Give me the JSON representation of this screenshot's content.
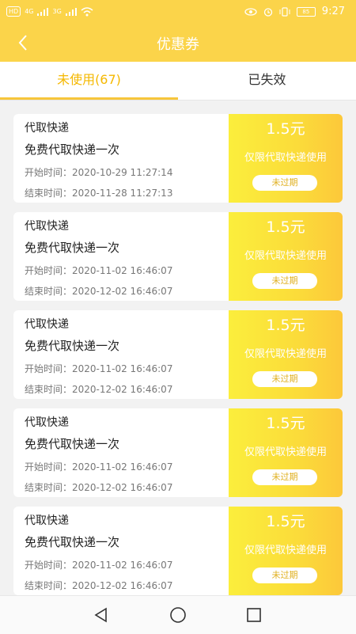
{
  "status_bar": {
    "left_badge": "HD",
    "signal_1": "4G",
    "signal_2": "3G",
    "battery": "85",
    "time": "9:27"
  },
  "header": {
    "title": "优惠券"
  },
  "tabs": [
    {
      "label": "未使用(67)",
      "active": true
    },
    {
      "label": "已失效",
      "active": false
    }
  ],
  "coupons": [
    {
      "category": "代取快递",
      "description": "免费代取快递一次",
      "start": "开始时间：2020-10-29 11:27:14",
      "end": "结束时间：2020-11-28 11:27:13",
      "amount": "1.5元",
      "limit": "仅限代取快递使用",
      "status": "未过期"
    },
    {
      "category": "代取快递",
      "description": "免费代取快递一次",
      "start": "开始时间：2020-11-02 16:46:07",
      "end": "结束时间：2020-12-02 16:46:07",
      "amount": "1.5元",
      "limit": "仅限代取快递使用",
      "status": "未过期"
    },
    {
      "category": "代取快递",
      "description": "免费代取快递一次",
      "start": "开始时间：2020-11-02 16:46:07",
      "end": "结束时间：2020-12-02 16:46:07",
      "amount": "1.5元",
      "limit": "仅限代取快递使用",
      "status": "未过期"
    },
    {
      "category": "代取快递",
      "description": "免费代取快递一次",
      "start": "开始时间：2020-11-02 16:46:07",
      "end": "结束时间：2020-12-02 16:46:07",
      "amount": "1.5元",
      "limit": "仅限代取快递使用",
      "status": "未过期"
    },
    {
      "category": "代取快递",
      "description": "免费代取快递一次",
      "start": "开始时间：2020-11-02 16:46:07",
      "end": "结束时间：2020-12-02 16:46:07",
      "amount": "1.5元",
      "limit": "仅限代取快递使用",
      "status": "未过期"
    }
  ],
  "colors": {
    "accent": "#fbd44a",
    "active_tab": "#f5b800",
    "coupon_yellow": "#fbe53a"
  },
  "nav_icons": [
    "back-triangle-icon",
    "home-circle-icon",
    "recents-square-icon"
  ]
}
